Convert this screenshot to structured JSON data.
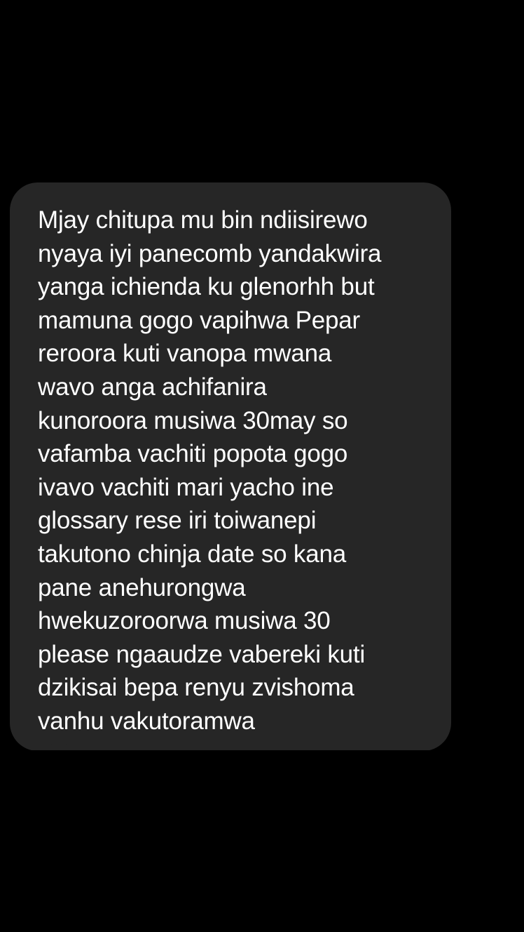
{
  "theme": {
    "background": "#000000",
    "bubble_color": "#262626",
    "text_color": "#ffffff"
  },
  "message": {
    "lines": [
      "Mjay chitupa mu bin ndiisirewo",
      "nyaya iyi panecomb yandakwira",
      "yanga ichienda ku glenorhh but",
      "mamuna gogo vapihwa Pepar",
      "reroora kuti vanopa mwana",
      "wavo anga achifanira",
      "kunoroora musiwa 30may so",
      "vafamba vachiti popota gogo",
      "ivavo vachiti mari yacho ine",
      "glossary rese iri toiwanepi",
      "takutono chinja date so kana",
      "pane anehurongwa",
      "hwekuzoroorwa musiwa 30",
      "please ngaaudze vabereki kuti",
      "dzikisai bepa renyu zvishoma",
      "vanhu vakutoramwa"
    ]
  }
}
